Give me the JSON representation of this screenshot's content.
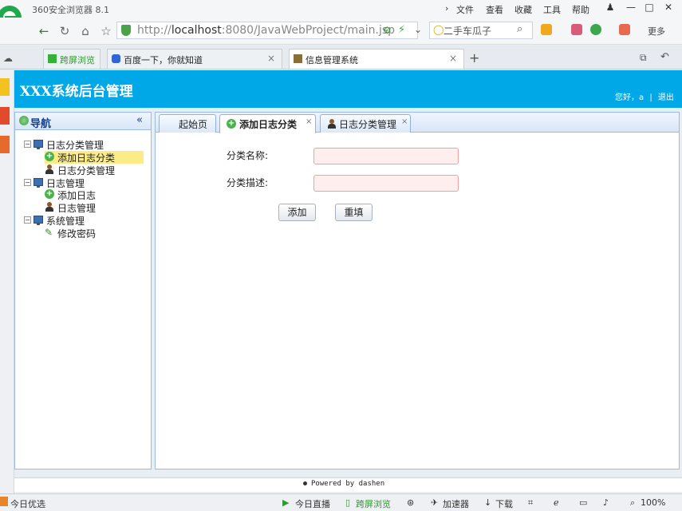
{
  "browser": {
    "app_name": "360安全浏览器 8.1",
    "menu": [
      "文件",
      "查看",
      "收藏",
      "工具",
      "帮助"
    ],
    "url_prefix": "http://",
    "url_host": "localhost",
    "url_rest": ":8080/JavaWebProject/main.jsp",
    "search_text": "二手车瓜子",
    "more_label": "更多",
    "tabs": [
      {
        "label": "跨屏浏览"
      },
      {
        "label": "百度一下，你就知道"
      },
      {
        "label": "信息管理系统"
      }
    ],
    "status": {
      "left": "今日优选",
      "live": "今日直播",
      "cross": "跨屏浏览",
      "accel": "加速器",
      "download": "下载",
      "zoom": "100%"
    }
  },
  "app": {
    "title": "XXX系统后台管理",
    "greeting": "您好，a",
    "separator": "|",
    "logout": "退出",
    "nav": {
      "title": "导航",
      "collapse_glyph": "«",
      "groups": [
        {
          "label": "日志分类管理",
          "items": [
            "添加日志分类",
            "日志分类管理"
          ]
        },
        {
          "label": "日志管理",
          "items": [
            "添加日志",
            "日志管理"
          ]
        },
        {
          "label": "系统管理",
          "items": [
            "修改密码"
          ]
        }
      ]
    },
    "tabs": [
      {
        "label": "起始页"
      },
      {
        "label": "添加日志分类"
      },
      {
        "label": "日志分类管理"
      }
    ],
    "form": {
      "name_label": "分类名称:",
      "desc_label": "分类描述:",
      "name_value": "",
      "desc_value": "",
      "add_button": "添加",
      "reset_button": "重填"
    },
    "footer": "Powered by dashen"
  }
}
